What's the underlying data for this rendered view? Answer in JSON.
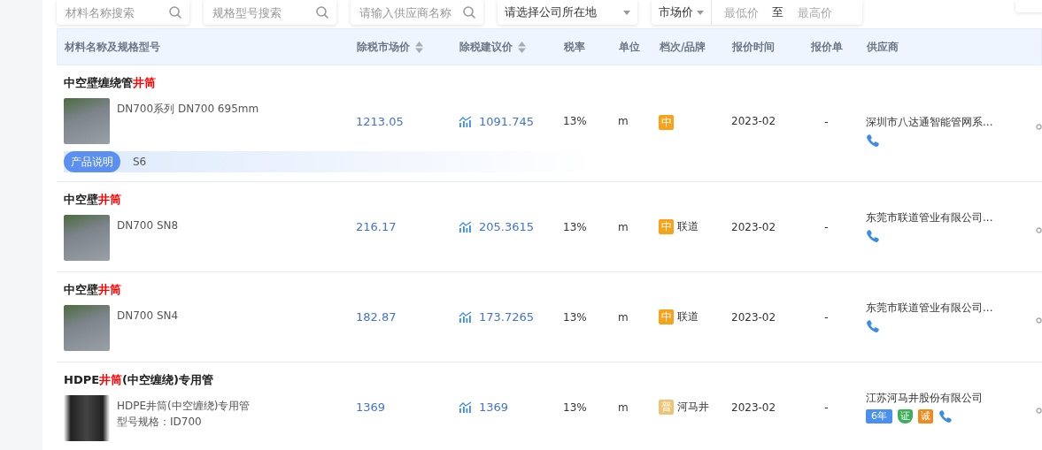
{
  "filters": [
    {
      "placeholder": "材料名称搜索"
    },
    {
      "placeholder": "规格型号搜索"
    },
    {
      "placeholder": "请输入供应商名称"
    }
  ],
  "location_select": {
    "placeholder": "请选择公司所在地"
  },
  "price_filter": {
    "type": "市场价",
    "min_placeholder": "最低价",
    "separator": "至",
    "max_placeholder": "最高价"
  },
  "table": {
    "columns": [
      {
        "label": "材料名称及规格型号",
        "sortable": false
      },
      {
        "label": "除税市场价",
        "sortable": true
      },
      {
        "label": "除税建议价",
        "sortable": true
      },
      {
        "label": "税率",
        "sortable": false
      },
      {
        "label": "单位",
        "sortable": false
      },
      {
        "label": "档次/品牌",
        "sortable": false
      },
      {
        "label": "报价时间",
        "sortable": false
      },
      {
        "label": "报价单",
        "sortable": false
      },
      {
        "label": "供应商",
        "sortable": false
      }
    ],
    "rows": [
      {
        "name": [
          {
            "text": "中空壁缠绕管",
            "highlight": false
          },
          {
            "text": "井筒",
            "highlight": true
          }
        ],
        "specs": [
          "DN700系列 DN700 695mm"
        ],
        "description_label": "产品说明",
        "description": "S6",
        "market_price": "1213.05",
        "suggested_price": "1091.745",
        "tax": "13%",
        "unit": "m",
        "grade": {
          "text": "中",
          "color": "#f7a21b"
        },
        "date": "2023-02",
        "quote": "-",
        "supplier": "深圳市八达通智能管网系...",
        "supplier_badges": []
      },
      {
        "name": [
          {
            "text": "中空壁",
            "highlight": false
          },
          {
            "text": "井筒",
            "highlight": true
          }
        ],
        "specs": [
          "DN700 SN8"
        ],
        "market_price": "216.17",
        "suggested_price": "205.3615",
        "tax": "13%",
        "unit": "m",
        "grade": {
          "text": "中",
          "color": "#f7a21b"
        },
        "brand": "联道",
        "date": "2023-02",
        "quote": "-",
        "supplier": "东莞市联道管业有限公司...",
        "supplier_badges": []
      },
      {
        "name": [
          {
            "text": "中空壁",
            "highlight": false
          },
          {
            "text": "井筒",
            "highlight": true
          }
        ],
        "specs": [
          "DN700 SN4"
        ],
        "market_price": "182.87",
        "suggested_price": "173.7265",
        "tax": "13%",
        "unit": "m",
        "grade": {
          "text": "中",
          "color": "#f7a21b"
        },
        "brand": "联道",
        "date": "2023-02",
        "quote": "-",
        "supplier": "东莞市联道管业有限公司...",
        "supplier_badges": []
      },
      {
        "name": [
          {
            "text": "HDPE",
            "highlight": false
          },
          {
            "text": "井筒",
            "highlight": true
          },
          {
            "text": "(中空缠绕)专用管",
            "highlight": false
          }
        ],
        "specs": [
          "HDPE井筒(中空缠绕)专用管",
          "型号规格：ID700"
        ],
        "market_price": "1369",
        "suggested_price": "1369",
        "tax": "13%",
        "unit": "m",
        "grade": {
          "text": "普",
          "color": "#f0c274"
        },
        "brand": "河马井",
        "date": "2023-02",
        "quote": "-",
        "supplier": "江苏河马井股份有限公司",
        "supplier_badges": [
          {
            "kind": "years",
            "text": "6年"
          },
          {
            "kind": "certified",
            "text": "证"
          },
          {
            "kind": "integrity",
            "text": "诚"
          }
        ]
      }
    ]
  }
}
